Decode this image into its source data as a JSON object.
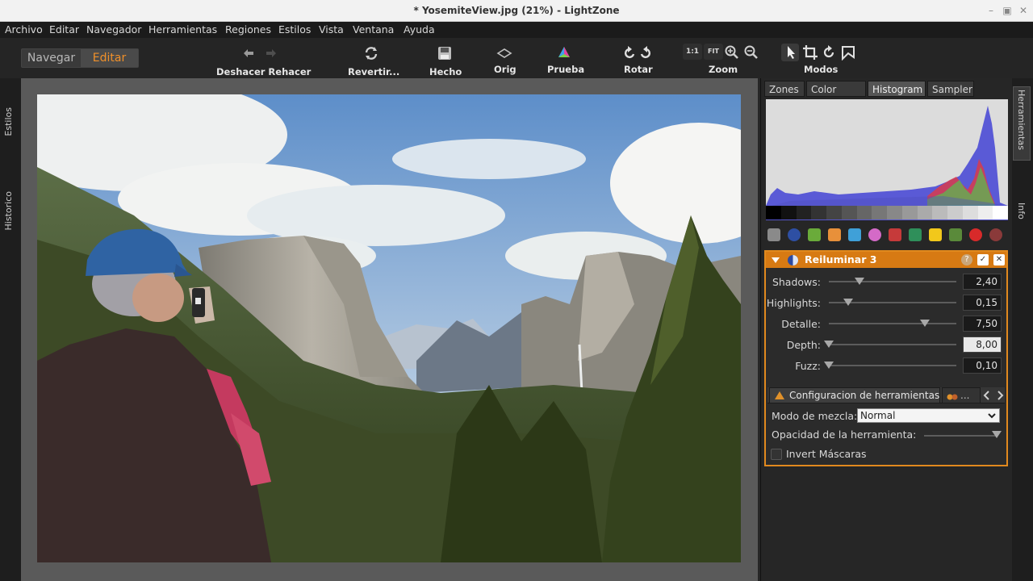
{
  "window": {
    "title": "* YosemiteView.jpg (21%) - LightZone"
  },
  "menu": [
    "Archivo",
    "Editar",
    "Navegador",
    "Herramientas",
    "Regiones",
    "Estilos",
    "Vista",
    "Ventana",
    "Ayuda"
  ],
  "modes": {
    "navegar": "Navegar",
    "editar": "Editar"
  },
  "toolbar": {
    "undo_redo": "Deshacer Rehacer",
    "revert": "Revertir...",
    "done": "Hecho",
    "orig": "Orig",
    "proof": "Prueba",
    "rotate": "Rotar",
    "zoom": "Zoom",
    "zoom_1to1": "1:1",
    "zoom_fit": "FIT",
    "modes": "Modos"
  },
  "left_tabs": {
    "styles": "Estilos",
    "history": "Historico"
  },
  "right_tabs": {
    "tools": "Herramientas",
    "info": "Info"
  },
  "panel_tabs": [
    {
      "label": "Zones"
    },
    {
      "label": "Color Mask"
    },
    {
      "label": "Histogram"
    },
    {
      "label": "Sampler"
    }
  ],
  "tool": {
    "title": "Reiluminar 3",
    "sliders": [
      {
        "label": "Shadows:",
        "value": "2,40",
        "fraction": 0.24
      },
      {
        "label": "Highlights:",
        "value": "0,15",
        "fraction": 0.15
      },
      {
        "label": "Detalle:",
        "value": "7,50",
        "fraction": 0.75
      },
      {
        "label": "Depth:",
        "value": "8,00",
        "fraction": 0.0
      },
      {
        "label": "Fuzz:",
        "value": "0,10",
        "fraction": 0.0
      }
    ],
    "config_tab": "Configuracion de herramientas",
    "more_tab": "...",
    "blend_label": "Modo de mezcla:",
    "blend_value": "Normal",
    "opacity_label": "Opacidad de la herramienta:",
    "opacity_fraction": 1.0,
    "invert_label": "Invert Máscaras"
  },
  "accent": "#e1891e"
}
